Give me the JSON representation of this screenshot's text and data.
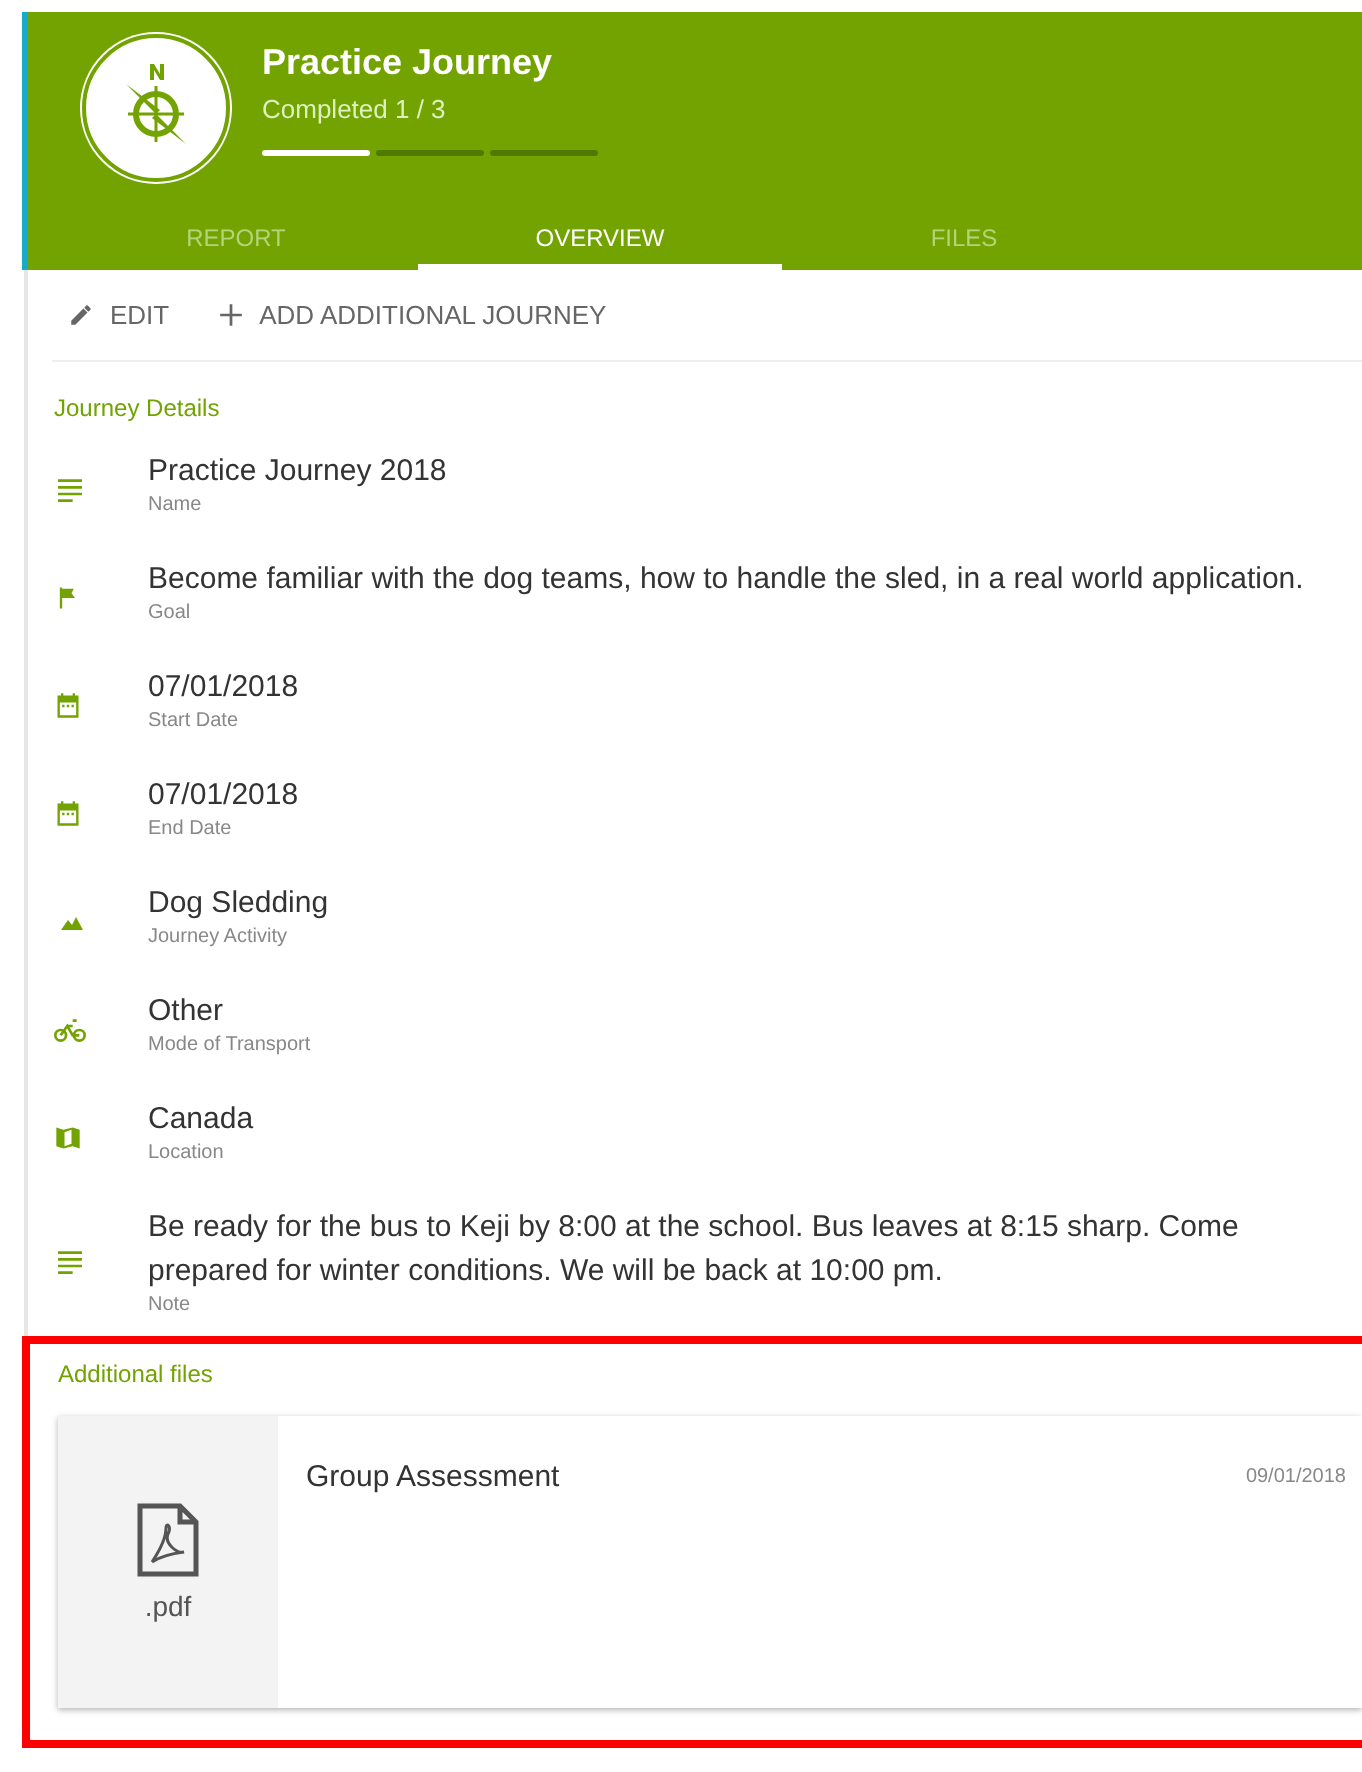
{
  "header": {
    "title": "Practice Journey",
    "subtitle": "Completed 1 / 3",
    "progress": [
      {
        "done": true
      },
      {
        "done": false
      },
      {
        "done": false
      }
    ]
  },
  "tabs": [
    {
      "label": "REPORT",
      "selected": false
    },
    {
      "label": "OVERVIEW",
      "selected": true
    },
    {
      "label": "FILES",
      "selected": false
    }
  ],
  "toolbar": [
    {
      "kind": "edit",
      "label": "EDIT"
    },
    {
      "kind": "add",
      "label": "ADD ADDITIONAL JOURNEY"
    }
  ],
  "details": {
    "title": "Journey Details",
    "items": [
      {
        "kind": "text",
        "value": "Practice Journey 2018",
        "label": "Name"
      },
      {
        "kind": "flag",
        "value": "Become familiar with the dog teams, how to handle the sled, in a real world application.",
        "label": "Goal"
      },
      {
        "kind": "calendar",
        "value": "07/01/2018",
        "label": "Start Date"
      },
      {
        "kind": "calendar",
        "value": "07/01/2018",
        "label": "End Date"
      },
      {
        "kind": "mountain",
        "value": "Dog Sledding",
        "label": "Journey Activity"
      },
      {
        "kind": "bike",
        "value": "Other",
        "label": "Mode of Transport"
      },
      {
        "kind": "map",
        "value": "Canada",
        "label": "Location"
      },
      {
        "kind": "text",
        "value": "Be ready for the bus to Keji by 8:00 at the school. Bus leaves at 8:15 sharp. Come prepared for winter conditions. We will be back at 10:00 pm.",
        "label": "Note"
      }
    ]
  },
  "files": {
    "title": "Additional files",
    "highlighted": true,
    "items": [
      {
        "name": "Group Assessment",
        "date": "09/01/2018",
        "extension": ".pdf"
      }
    ]
  }
}
